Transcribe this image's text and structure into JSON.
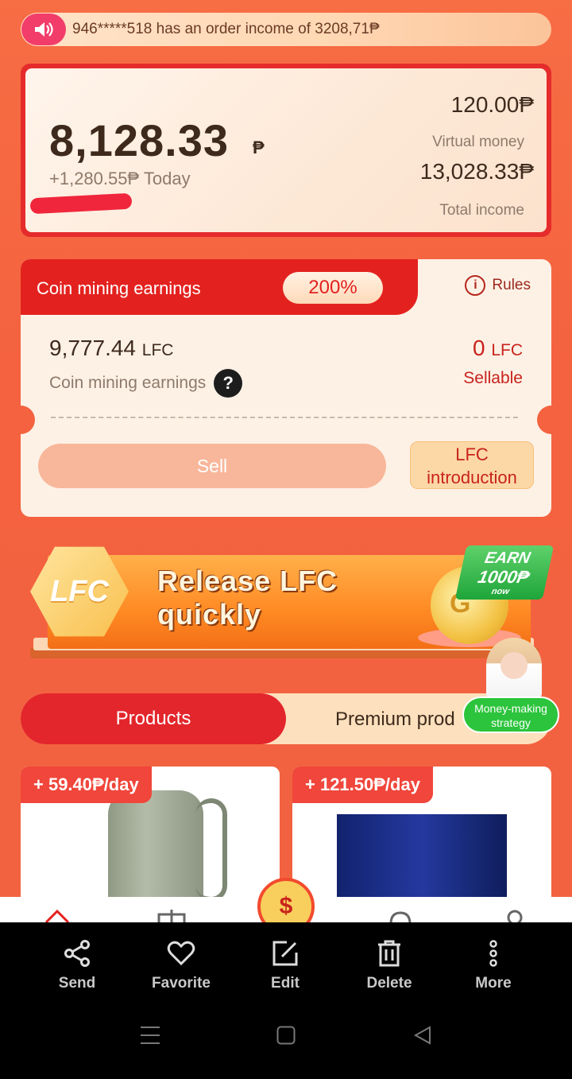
{
  "ticker": {
    "message": "946*****518 has an order income of 3208,71₱"
  },
  "balance": {
    "main_value": "8,128.33",
    "currency": "₱",
    "today": "+1,280.55₱ Today",
    "virtual_value": "120.00₱",
    "virtual_label": "Virtual money",
    "total_value": "13,028.33₱",
    "total_label": "Total income"
  },
  "mining": {
    "title": "Coin mining earnings",
    "rate": "200%",
    "rules_label": "Rules",
    "coin_value": "9,777.44",
    "coin_unit": "LFC",
    "coin_label": "Coin mining earnings",
    "sellable_value": "0",
    "sellable_unit": "LFC",
    "sellable_label": "Sellable",
    "sell_button": "Sell",
    "intro_line1": "LFC",
    "intro_line2": "introduction"
  },
  "banner": {
    "hex_text": "LFC",
    "line1": "Release LFC",
    "line2": "quickly",
    "coin_text": "G",
    "earn_line1": "EARN",
    "earn_line2": "1000₱",
    "earn_line3": "now"
  },
  "money_badge": {
    "line1": "Money-making",
    "line2": "strategy"
  },
  "tabs": {
    "active": "Products",
    "other": "Premium prod"
  },
  "products": [
    {
      "tag": "+ 59.40₱/day"
    },
    {
      "tag": "+ 121.50₱/day"
    }
  ],
  "nav_center_symbol": "$",
  "actions": [
    "Send",
    "Favorite",
    "Edit",
    "Delete",
    "More"
  ],
  "colors": {
    "accent_red": "#e3221f",
    "background": "#f4623f",
    "badge_green": "#2cc43c"
  }
}
